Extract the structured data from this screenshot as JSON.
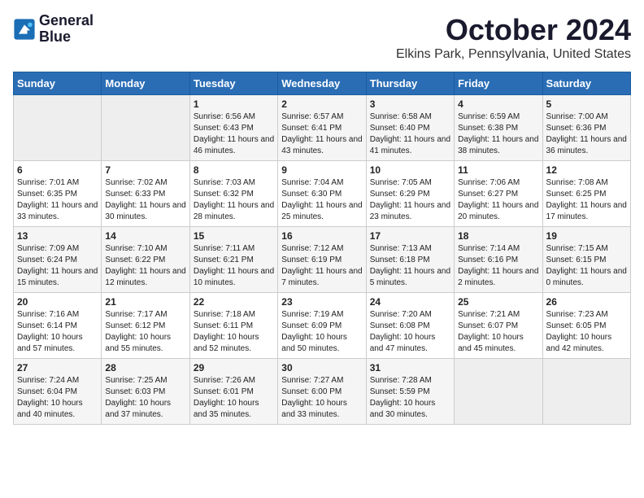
{
  "header": {
    "logo_line1": "General",
    "logo_line2": "Blue",
    "month": "October 2024",
    "location": "Elkins Park, Pennsylvania, United States"
  },
  "weekdays": [
    "Sunday",
    "Monday",
    "Tuesday",
    "Wednesday",
    "Thursday",
    "Friday",
    "Saturday"
  ],
  "weeks": [
    [
      {
        "day": "",
        "info": ""
      },
      {
        "day": "",
        "info": ""
      },
      {
        "day": "1",
        "info": "Sunrise: 6:56 AM\nSunset: 6:43 PM\nDaylight: 11 hours and 46 minutes."
      },
      {
        "day": "2",
        "info": "Sunrise: 6:57 AM\nSunset: 6:41 PM\nDaylight: 11 hours and 43 minutes."
      },
      {
        "day": "3",
        "info": "Sunrise: 6:58 AM\nSunset: 6:40 PM\nDaylight: 11 hours and 41 minutes."
      },
      {
        "day": "4",
        "info": "Sunrise: 6:59 AM\nSunset: 6:38 PM\nDaylight: 11 hours and 38 minutes."
      },
      {
        "day": "5",
        "info": "Sunrise: 7:00 AM\nSunset: 6:36 PM\nDaylight: 11 hours and 36 minutes."
      }
    ],
    [
      {
        "day": "6",
        "info": "Sunrise: 7:01 AM\nSunset: 6:35 PM\nDaylight: 11 hours and 33 minutes."
      },
      {
        "day": "7",
        "info": "Sunrise: 7:02 AM\nSunset: 6:33 PM\nDaylight: 11 hours and 30 minutes."
      },
      {
        "day": "8",
        "info": "Sunrise: 7:03 AM\nSunset: 6:32 PM\nDaylight: 11 hours and 28 minutes."
      },
      {
        "day": "9",
        "info": "Sunrise: 7:04 AM\nSunset: 6:30 PM\nDaylight: 11 hours and 25 minutes."
      },
      {
        "day": "10",
        "info": "Sunrise: 7:05 AM\nSunset: 6:29 PM\nDaylight: 11 hours and 23 minutes."
      },
      {
        "day": "11",
        "info": "Sunrise: 7:06 AM\nSunset: 6:27 PM\nDaylight: 11 hours and 20 minutes."
      },
      {
        "day": "12",
        "info": "Sunrise: 7:08 AM\nSunset: 6:25 PM\nDaylight: 11 hours and 17 minutes."
      }
    ],
    [
      {
        "day": "13",
        "info": "Sunrise: 7:09 AM\nSunset: 6:24 PM\nDaylight: 11 hours and 15 minutes."
      },
      {
        "day": "14",
        "info": "Sunrise: 7:10 AM\nSunset: 6:22 PM\nDaylight: 11 hours and 12 minutes."
      },
      {
        "day": "15",
        "info": "Sunrise: 7:11 AM\nSunset: 6:21 PM\nDaylight: 11 hours and 10 minutes."
      },
      {
        "day": "16",
        "info": "Sunrise: 7:12 AM\nSunset: 6:19 PM\nDaylight: 11 hours and 7 minutes."
      },
      {
        "day": "17",
        "info": "Sunrise: 7:13 AM\nSunset: 6:18 PM\nDaylight: 11 hours and 5 minutes."
      },
      {
        "day": "18",
        "info": "Sunrise: 7:14 AM\nSunset: 6:16 PM\nDaylight: 11 hours and 2 minutes."
      },
      {
        "day": "19",
        "info": "Sunrise: 7:15 AM\nSunset: 6:15 PM\nDaylight: 11 hours and 0 minutes."
      }
    ],
    [
      {
        "day": "20",
        "info": "Sunrise: 7:16 AM\nSunset: 6:14 PM\nDaylight: 10 hours and 57 minutes."
      },
      {
        "day": "21",
        "info": "Sunrise: 7:17 AM\nSunset: 6:12 PM\nDaylight: 10 hours and 55 minutes."
      },
      {
        "day": "22",
        "info": "Sunrise: 7:18 AM\nSunset: 6:11 PM\nDaylight: 10 hours and 52 minutes."
      },
      {
        "day": "23",
        "info": "Sunrise: 7:19 AM\nSunset: 6:09 PM\nDaylight: 10 hours and 50 minutes."
      },
      {
        "day": "24",
        "info": "Sunrise: 7:20 AM\nSunset: 6:08 PM\nDaylight: 10 hours and 47 minutes."
      },
      {
        "day": "25",
        "info": "Sunrise: 7:21 AM\nSunset: 6:07 PM\nDaylight: 10 hours and 45 minutes."
      },
      {
        "day": "26",
        "info": "Sunrise: 7:23 AM\nSunset: 6:05 PM\nDaylight: 10 hours and 42 minutes."
      }
    ],
    [
      {
        "day": "27",
        "info": "Sunrise: 7:24 AM\nSunset: 6:04 PM\nDaylight: 10 hours and 40 minutes."
      },
      {
        "day": "28",
        "info": "Sunrise: 7:25 AM\nSunset: 6:03 PM\nDaylight: 10 hours and 37 minutes."
      },
      {
        "day": "29",
        "info": "Sunrise: 7:26 AM\nSunset: 6:01 PM\nDaylight: 10 hours and 35 minutes."
      },
      {
        "day": "30",
        "info": "Sunrise: 7:27 AM\nSunset: 6:00 PM\nDaylight: 10 hours and 33 minutes."
      },
      {
        "day": "31",
        "info": "Sunrise: 7:28 AM\nSunset: 5:59 PM\nDaylight: 10 hours and 30 minutes."
      },
      {
        "day": "",
        "info": ""
      },
      {
        "day": "",
        "info": ""
      }
    ]
  ]
}
